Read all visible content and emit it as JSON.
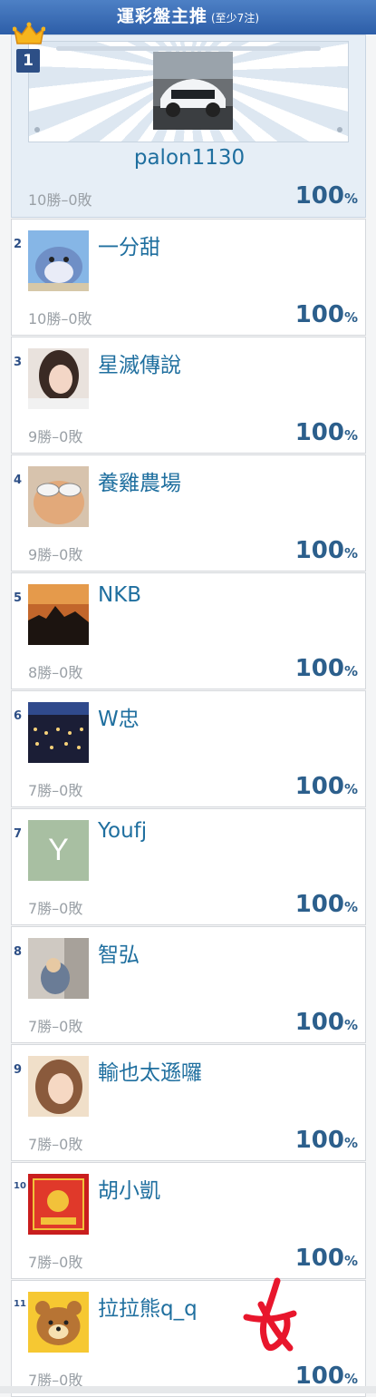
{
  "header": {
    "title": "運彩盤主推",
    "subtitle": "(至少7注)"
  },
  "first": {
    "rank": "1",
    "name": "palon1130",
    "record": "10勝–0敗",
    "percent": "100",
    "percent_unit": "%"
  },
  "rows": [
    {
      "rank": "2",
      "name": "一分甜",
      "record": "10勝–0敗",
      "percent": "100",
      "percent_unit": "%"
    },
    {
      "rank": "3",
      "name": "星滅傳說",
      "record": "9勝–0敗",
      "percent": "100",
      "percent_unit": "%"
    },
    {
      "rank": "4",
      "name": "養雞農場",
      "record": "9勝–0敗",
      "percent": "100",
      "percent_unit": "%"
    },
    {
      "rank": "5",
      "name": "NKB",
      "record": "8勝–0敗",
      "percent": "100",
      "percent_unit": "%"
    },
    {
      "rank": "6",
      "name": "W忠",
      "record": "7勝–0敗",
      "percent": "100",
      "percent_unit": "%"
    },
    {
      "rank": "7",
      "name": "Youfj",
      "avatar_letter": "Y",
      "record": "7勝–0敗",
      "percent": "100",
      "percent_unit": "%"
    },
    {
      "rank": "8",
      "name": "智弘",
      "record": "7勝–0敗",
      "percent": "100",
      "percent_unit": "%"
    },
    {
      "rank": "9",
      "name": "輸也太遜囉",
      "record": "7勝–0敗",
      "percent": "100",
      "percent_unit": "%"
    },
    {
      "rank": "10",
      "name": "胡小凱",
      "record": "7勝–0敗",
      "percent": "100",
      "percent_unit": "%"
    },
    {
      "rank": "11",
      "name": "拉拉熊q_q",
      "record": "7勝–0敗",
      "percent": "100",
      "percent_unit": "%"
    }
  ],
  "colors": {
    "header": "#2d5ea8",
    "name": "#1f6f9f",
    "percent": "#2c5f8c",
    "mark": "#e8162c"
  }
}
